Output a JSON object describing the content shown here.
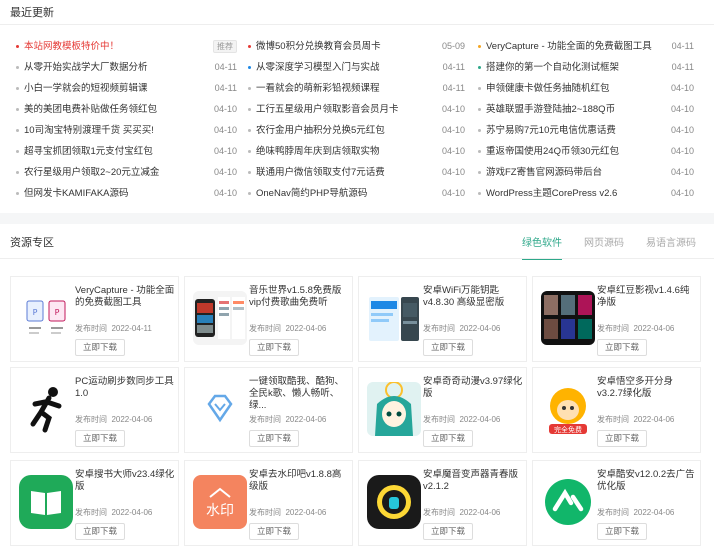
{
  "recent": {
    "title": "最近更新",
    "columns": [
      [
        {
          "text": "本站网教模板特价中！",
          "date": "",
          "tag": "推荐",
          "hl": "#e53935"
        },
        {
          "text": "从零开始实战学大厂数据分析",
          "date": "04-11"
        },
        {
          "text": "小白一学就会的短视频剪辑课",
          "date": "04-11"
        },
        {
          "text": "美的美团电费补贴做任务领红包",
          "date": "04-10"
        },
        {
          "text": "10司淘宝特别渡理千货 买买买!",
          "date": "04-10"
        },
        {
          "text": "超寻宝抓团领取1元支付宝红包",
          "date": "04-10"
        },
        {
          "text": "农行星级用户领取2~20元立减金",
          "date": "04-10"
        },
        {
          "text": "但网发卡KAMIFAKA源码",
          "date": "04-10"
        }
      ],
      [
        {
          "text": "微博50积分兑换教育会员周卡",
          "date": "05-09",
          "hl": "#e53935"
        },
        {
          "text": "从零深度学习模型入门与实战",
          "date": "04-11",
          "hl": "#1e88e5"
        },
        {
          "text": "一看就会的萌新彩铅视频课程",
          "date": "04-11"
        },
        {
          "text": "工行五星级用户领取影音会员月卡",
          "date": "04-10"
        },
        {
          "text": "农行金用户抽积分兑换5元红包",
          "date": "04-10"
        },
        {
          "text": "绝味鸭脖周年庆到店领取实物",
          "date": "04-10"
        },
        {
          "text": "联通用户微信领取支付7元话费",
          "date": "04-10"
        },
        {
          "text": "OneNav简约PHP导航源码",
          "date": "04-10"
        }
      ],
      [
        {
          "text": "VeryCapture - 功能全面的免费截图工具",
          "date": "04-11",
          "hl": "#f5a623"
        },
        {
          "text": "搭建你的第一个自动化测试框架",
          "date": "04-11",
          "hl": "#2ea88a"
        },
        {
          "text": "申领健康卡做任务抽随机红包",
          "date": "04-10"
        },
        {
          "text": "英雄联盟手游登陆抽2~188Q币",
          "date": "04-10"
        },
        {
          "text": "苏宁易购7元10元电信优惠话费",
          "date": "04-10"
        },
        {
          "text": "重返帝国使用24Q币领30元红包",
          "date": "04-10"
        },
        {
          "text": "游戏FZ寄售官网源码带后台",
          "date": "04-10"
        },
        {
          "text": "WordPress主题CorePress v2.6",
          "date": "04-10"
        }
      ]
    ]
  },
  "resources": {
    "title": "资源专区",
    "tabs": [
      "绿色软件",
      "网页源码",
      "易语言源码"
    ],
    "active_tab": 0,
    "date_prefix": "发布时间",
    "download_label": "立即下载",
    "cards": [
      {
        "title": "VeryCapture - 功能全面的免费截图工具",
        "date": "2022-04-11",
        "icon": "capture-app-icon"
      },
      {
        "title": "音乐世界v1.5.8免费版vip付费歌曲免费听",
        "date": "2022-04-06",
        "icon": "music-world-app-icon"
      },
      {
        "title": "安卓WiFi万能钥匙v4.8.30 高级显密版",
        "date": "2022-04-06",
        "icon": "wifi-key-app-icon"
      },
      {
        "title": "安卓红豆影视v1.4.6纯净版",
        "date": "2022-04-06",
        "icon": "movie-app-icon"
      },
      {
        "title": "PC运动刷步数同步工具1.0",
        "date": "2022-04-06",
        "icon": "running-man-icon"
      },
      {
        "title": "一键领取酷我、酷狗、全民k歌、懒人畅听、绿...",
        "date": "2022-04-06",
        "icon": "diamond-shape-icon"
      },
      {
        "title": "安卓奇奇动漫v3.97绿化版",
        "date": "2022-04-06",
        "icon": "anime-girl-icon"
      },
      {
        "title": "安卓悟空多开分身v3.2.7绿化版",
        "date": "2022-04-06",
        "icon": "monkey-king-icon"
      },
      {
        "title": "安卓搜书大师v23.4绿化版",
        "date": "2022-04-06",
        "icon": "book-app-icon"
      },
      {
        "title": "安卓去水印吧v1.8.8高级版",
        "date": "2022-04-06",
        "icon": "watermark-app-icon"
      },
      {
        "title": "安卓魔音变声器青春版v2.1.2",
        "date": "2022-04-06",
        "icon": "voice-changer-icon"
      },
      {
        "title": "安卓酷安v12.0.2去广告优化版",
        "date": "2022-04-06",
        "icon": "coolapk-icon"
      }
    ],
    "icon_texts": {
      "watermark": "水印",
      "wukong_badge": "完全免费"
    }
  },
  "colors": {
    "accent": "#2ea88a",
    "red": "#e53935",
    "blue": "#1e88e5",
    "orange": "#f5a623"
  }
}
